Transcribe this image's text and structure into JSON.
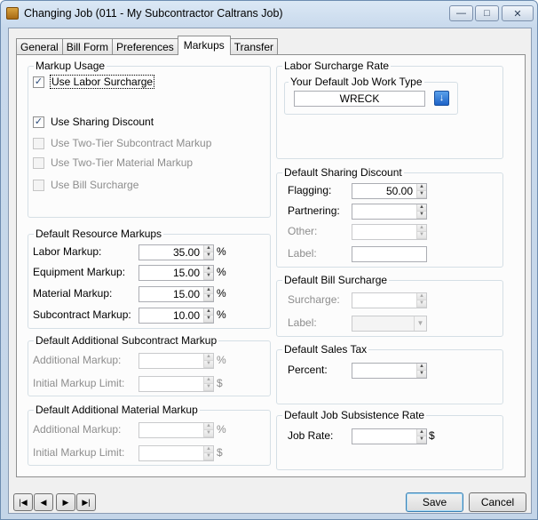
{
  "window": {
    "title": "Changing Job  (011 - My Subcontractor Caltrans Job)",
    "buttons": {
      "minimize": "—",
      "maximize": "□",
      "close": "✕"
    }
  },
  "tabs": [
    {
      "label": "General"
    },
    {
      "label": "Bill Form"
    },
    {
      "label": "Preferences"
    },
    {
      "label": "Markups"
    },
    {
      "label": "Transfer"
    }
  ],
  "markup_usage": {
    "legend": "Markup Usage",
    "use_labor_surcharge": {
      "label": "Use Labor Surcharge",
      "checked": "✓"
    },
    "use_sharing_discount": {
      "label": "Use Sharing Discount",
      "checked": "✓"
    },
    "use_two_tier_subcontract": {
      "label": "Use Two-Tier Subcontract Markup"
    },
    "use_two_tier_material": {
      "label": "Use Two-Tier Material Markup"
    },
    "use_bill_surcharge": {
      "label": "Use Bill Surcharge"
    }
  },
  "resource_markups": {
    "legend": "Default Resource Markups",
    "labor": {
      "label": "Labor Markup:",
      "value": "35.00",
      "unit": "%"
    },
    "equipment": {
      "label": "Equipment Markup:",
      "value": "15.00",
      "unit": "%"
    },
    "material": {
      "label": "Material Markup:",
      "value": "15.00",
      "unit": "%"
    },
    "subcontract": {
      "label": "Subcontract Markup:",
      "value": "10.00",
      "unit": "%"
    }
  },
  "additional_subcontract": {
    "legend": "Default Additional Subcontract Markup",
    "additional": {
      "label": "Additional Markup:",
      "value": "",
      "unit": "%"
    },
    "limit": {
      "label": "Initial Markup Limit:",
      "value": "",
      "unit": "$"
    }
  },
  "additional_material": {
    "legend": "Default Additional Material Markup",
    "additional": {
      "label": "Additional Markup:",
      "value": "",
      "unit": "%"
    },
    "limit": {
      "label": "Initial Markup Limit:",
      "value": "",
      "unit": "$"
    }
  },
  "labor_surcharge_rate": {
    "legend": "Labor Surcharge Rate",
    "sub_legend": "Your Default Job Work Type",
    "value": "WRECK",
    "lookup_icon": "↓"
  },
  "sharing_discount": {
    "legend": "Default Sharing Discount",
    "flagging": {
      "label": "Flagging:",
      "value": "50.00"
    },
    "partnering": {
      "label": "Partnering:",
      "value": ""
    },
    "other": {
      "label": "Other:",
      "value": ""
    },
    "label_field": {
      "label": "Label:",
      "value": ""
    }
  },
  "bill_surcharge": {
    "legend": "Default Bill Surcharge",
    "surcharge": {
      "label": "Surcharge:",
      "value": ""
    },
    "label_field": {
      "label": "Label:",
      "value": ""
    }
  },
  "sales_tax": {
    "legend": "Default Sales Tax",
    "percent": {
      "label": "Percent:",
      "value": ""
    }
  },
  "subsistence_rate": {
    "legend": "Default Job Subsistence Rate",
    "job_rate": {
      "label": "Job Rate:",
      "value": "",
      "unit": "$"
    }
  },
  "footer": {
    "first": "|◀",
    "prev": "◀",
    "next": "▶",
    "last": "▶|",
    "save": "Save",
    "cancel": "Cancel"
  }
}
